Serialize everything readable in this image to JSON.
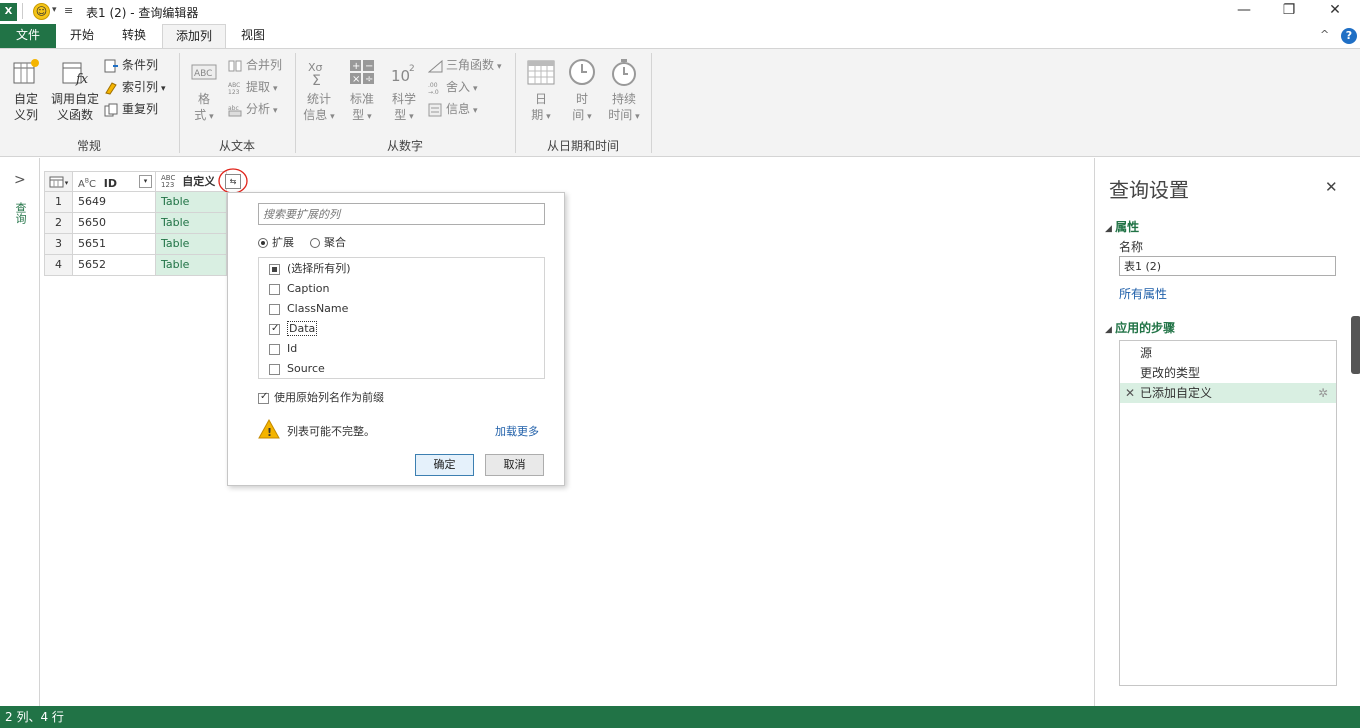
{
  "window": {
    "title": "表1 (2) - 查询编辑器",
    "app_icon": "X",
    "minimize": "—",
    "restore": "❐",
    "close": "✕"
  },
  "tabs": [
    {
      "label": "文件"
    },
    {
      "label": "开始"
    },
    {
      "label": "转换"
    },
    {
      "label": "添加列"
    },
    {
      "label": "视图"
    }
  ],
  "ribbon": {
    "help": "?",
    "collapse": "^",
    "groups": {
      "general": "常规",
      "from_text": "从文本",
      "from_number": "从数字",
      "from_datetime": "从日期和时间"
    },
    "custom_column": [
      "自定",
      "义列"
    ],
    "invoke_function": [
      "调用自定",
      "义函数"
    ],
    "conditional_column": "条件列",
    "index_column": "索引列",
    "duplicate_column": "重复列",
    "format": [
      "格",
      "式"
    ],
    "merge_columns": "合并列",
    "extract": "提取",
    "parse": "分析",
    "statistics": [
      "统计",
      "信息"
    ],
    "standard": [
      "标准",
      "型"
    ],
    "scientific": [
      "科学",
      "型"
    ],
    "trigonometry": "三角函数",
    "rounding": "舍入",
    "information": "信息",
    "date": [
      "日",
      "期"
    ],
    "time": [
      "时",
      "间"
    ],
    "duration": [
      "持续",
      "时间"
    ]
  },
  "leftpane": {
    "expand": ">",
    "label": "查询"
  },
  "grid": {
    "columns": [
      {
        "name": "ID",
        "type": "ABC"
      },
      {
        "name": "自定义",
        "type": "ABC\n123"
      }
    ],
    "rows": [
      {
        "num": "1",
        "id": "5649",
        "custom": "Table"
      },
      {
        "num": "2",
        "id": "5650",
        "custom": "Table"
      },
      {
        "num": "3",
        "id": "5651",
        "custom": "Table"
      },
      {
        "num": "4",
        "id": "5652",
        "custom": "Table"
      }
    ]
  },
  "popup": {
    "search_placeholder": "搜索要扩展的列",
    "expand": "扩展",
    "aggregate": "聚合",
    "select_all": "(选择所有列)",
    "items": [
      {
        "label": "Caption",
        "checked": false
      },
      {
        "label": "ClassName",
        "checked": false
      },
      {
        "label": "Data",
        "checked": true
      },
      {
        "label": "Id",
        "checked": false
      },
      {
        "label": "Source",
        "checked": false
      }
    ],
    "prefix_option": "使用原始列名作为前缀",
    "warning": "列表可能不完整。",
    "load_more": "加载更多",
    "ok": "确定",
    "cancel": "取消"
  },
  "settings": {
    "title": "查询设置",
    "close": "✕",
    "properties_header": "属性",
    "name_label": "名称",
    "name_value": "表1 (2)",
    "all_properties": "所有属性",
    "steps_header": "应用的步骤",
    "steps": [
      "源",
      "更改的类型",
      "已添加自定义"
    ]
  },
  "status": {
    "text": "2 列、4 行"
  },
  "colors": {
    "accent": "#217346",
    "selection": "#d9efe2",
    "annotation": "#e0241b"
  }
}
